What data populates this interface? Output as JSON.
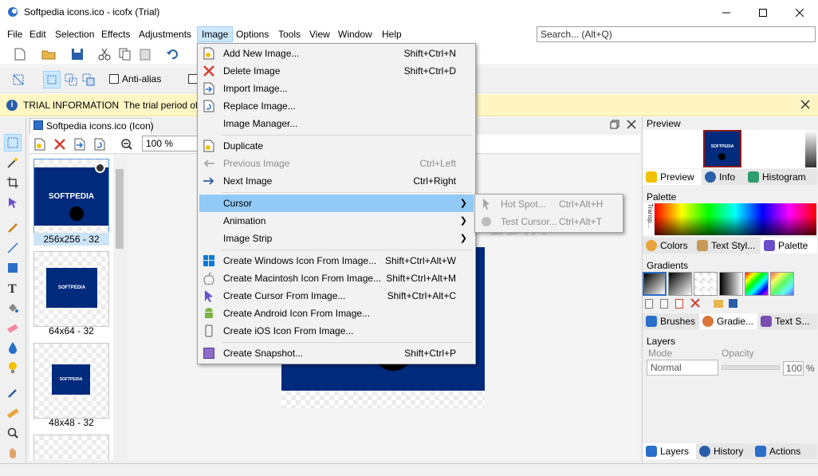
{
  "window": {
    "title": "Softpedia icons.ico - icofx (Trial)"
  },
  "menubar": {
    "items": [
      "File",
      "Edit",
      "Selection",
      "Effects",
      "Adjustments",
      "Image",
      "Options",
      "Tools",
      "View",
      "Window",
      "Help"
    ]
  },
  "search": {
    "placeholder": "Search... (Alt+Q)"
  },
  "toolbar2": {
    "antialias_label": "Anti-alias"
  },
  "trial": {
    "label": "TRIAL INFORMATION",
    "text": "The trial period of"
  },
  "document": {
    "tab_label": "Softpedia icons.ico (Icon)",
    "zoom": "100 %"
  },
  "thumbnails": [
    {
      "label": "256x256 - 32",
      "brand": "SOFTPEDIA"
    },
    {
      "label": "64x64 - 32",
      "brand": "SOFTPEDIA"
    },
    {
      "label": "48x48 - 32",
      "brand": "SOFTPEDIA"
    }
  ],
  "image_menu": {
    "items": [
      {
        "label": "Add New Image...",
        "shortcut": "Shift+Ctrl+N"
      },
      {
        "label": "Delete Image",
        "shortcut": "Shift+Ctrl+D"
      },
      {
        "label": "Import Image...",
        "shortcut": ""
      },
      {
        "label": "Replace Image...",
        "shortcut": ""
      },
      {
        "label": "Image Manager...",
        "shortcut": ""
      },
      {
        "label": "Duplicate",
        "shortcut": ""
      },
      {
        "label": "Previous Image",
        "shortcut": "Ctrl+Left"
      },
      {
        "label": "Next Image",
        "shortcut": "Ctrl+Right"
      },
      {
        "label": "Cursor",
        "shortcut": ""
      },
      {
        "label": "Animation",
        "shortcut": ""
      },
      {
        "label": "Image Strip",
        "shortcut": ""
      },
      {
        "label": "Create Windows Icon From Image...",
        "shortcut": "Shift+Ctrl+Alt+W"
      },
      {
        "label": "Create Macintosh Icon From Image...",
        "shortcut": "Shift+Ctrl+Alt+M"
      },
      {
        "label": "Create Cursor From Image...",
        "shortcut": "Shift+Ctrl+Alt+C"
      },
      {
        "label": "Create Android Icon From Image...",
        "shortcut": ""
      },
      {
        "label": "Create iOS Icon From Image...",
        "shortcut": ""
      },
      {
        "label": "Create Snapshot...",
        "shortcut": "Shift+Ctrl+P"
      }
    ]
  },
  "cursor_submenu": {
    "items": [
      {
        "label": "Hot Spot...",
        "shortcut": "Ctrl+Alt+H"
      },
      {
        "label": "Test Cursor...",
        "shortcut": "Ctrl+Alt+T"
      }
    ]
  },
  "panels": {
    "preview": {
      "title": "Preview",
      "tabs": [
        "Preview",
        "Info",
        "Histogram"
      ],
      "brand": "SOFTPEDIA"
    },
    "palette": {
      "title": "Palette",
      "tabs": [
        "Colors",
        "Text Styl...",
        "Palette"
      ],
      "side_label": "Transp..."
    },
    "gradients": {
      "title": "Gradients",
      "tabs": [
        "Brushes",
        "Gradie...",
        "Text S..."
      ]
    },
    "layers": {
      "title": "Layers",
      "mode_label": "Mode",
      "opacity_label": "Opacity",
      "mode_value": "Normal",
      "opacity_value": "100",
      "percent": "%",
      "tabs": [
        "Layers",
        "History",
        "Actions"
      ]
    }
  },
  "watermark": "SOFTPEDIA",
  "colors": {
    "menu_highlight": "#91c9f7",
    "trial_bg": "#fff6c4",
    "icon_blue": "#002a7c"
  }
}
